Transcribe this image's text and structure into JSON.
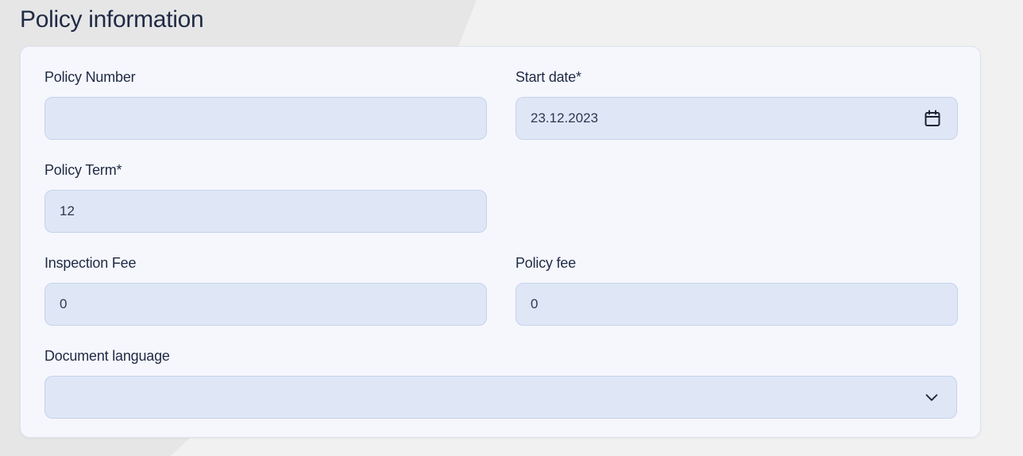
{
  "page": {
    "title": "Policy information"
  },
  "form": {
    "policy_number": {
      "label": "Policy Number",
      "value": ""
    },
    "start_date": {
      "label": "Start date*",
      "value": "23.12.2023",
      "icon": "calendar-icon"
    },
    "policy_term": {
      "label": "Policy Term*",
      "value": "12"
    },
    "inspection_fee": {
      "label": "Inspection Fee",
      "value": "0"
    },
    "policy_fee": {
      "label": "Policy fee",
      "value": "0"
    },
    "document_language": {
      "label": "Document language",
      "value": "",
      "icon": "chevron-down-icon"
    }
  },
  "colors": {
    "background": "#e9e9ea",
    "card": "#f6f7fd",
    "field_fill": "#dfe7f6",
    "field_border": "#c4d2ea",
    "text": "#1f2a44"
  }
}
